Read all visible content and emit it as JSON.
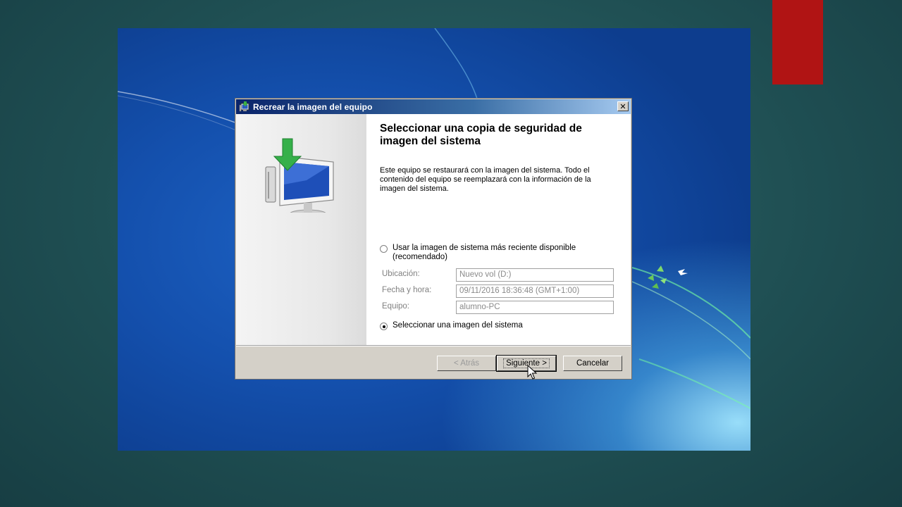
{
  "window": {
    "title": "Recrear la imagen del equipo",
    "close_glyph": "✕"
  },
  "wizard": {
    "heading": "Seleccionar una copia de seguridad de imagen del sistema",
    "description": "Este equipo se restaurará con la imagen del sistema. Todo el contenido del equipo se reemplazará con la información de la imagen del sistema.",
    "option_latest": {
      "label": "Usar la imagen de sistema más reciente disponible (recomendado)",
      "selected": false
    },
    "fields": {
      "location_label": "Ubicación:",
      "location_value": "Nuevo vol (D:)",
      "datetime_label": "Fecha y hora:",
      "datetime_value": "09/11/2016 18:36:48 (GMT+1:00)",
      "computer_label": "Equipo:",
      "computer_value": "alumno-PC"
    },
    "option_select": {
      "label": "Seleccionar una imagen del sistema",
      "selected": true
    }
  },
  "buttons": {
    "back": "< Atrás",
    "next": "Siguiente >",
    "cancel": "Cancelar"
  },
  "icons": {
    "title_icon": "backup-restore-icon",
    "illustration": "monitor-restore-arrow-icon",
    "cursor": "mouse-pointer-icon"
  }
}
